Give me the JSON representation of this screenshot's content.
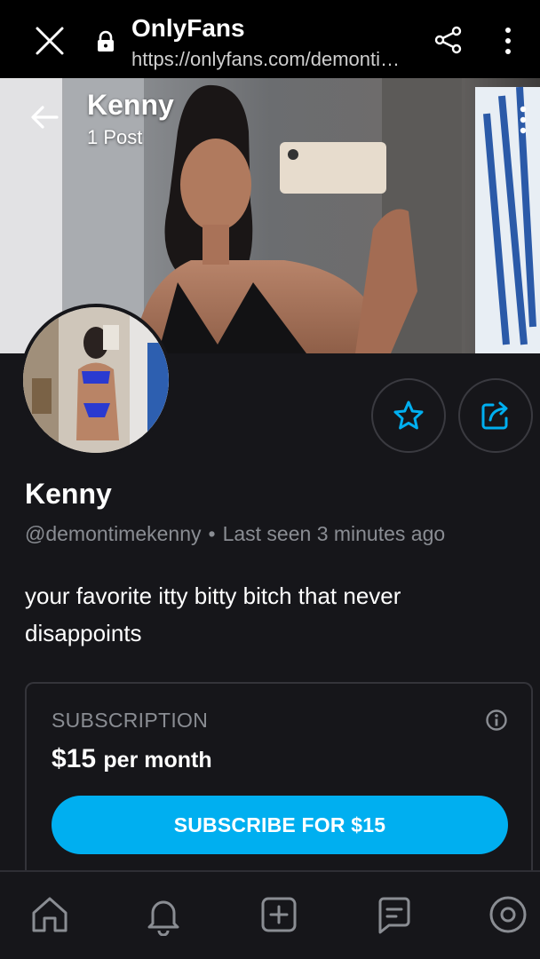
{
  "browser": {
    "title": "OnlyFans",
    "url": "https://onlyfans.com/demonti…"
  },
  "cover": {
    "name": "Kenny",
    "posts": "1 Post"
  },
  "profile": {
    "name": "Kenny",
    "handle": "@demontimekenny",
    "separator": "•",
    "last_seen": "Last seen 3 minutes ago",
    "bio": "your favorite itty bitty bitch that never disappoints"
  },
  "subscription": {
    "label": "SUBSCRIPTION",
    "price": "$15",
    "period": "per month",
    "button": "SUBSCRIBE FOR $15"
  },
  "colors": {
    "accent": "#00aff0",
    "background": "#16161a",
    "muted_text": "#8a8d93"
  },
  "icons": [
    "close-icon",
    "lock-icon",
    "share-icon",
    "kebab-icon",
    "back-arrow-icon",
    "more-vertical-icon",
    "star-icon",
    "share-out-icon",
    "info-icon",
    "home-icon",
    "bell-icon",
    "plus-square-icon",
    "message-icon",
    "profile-icon"
  ]
}
